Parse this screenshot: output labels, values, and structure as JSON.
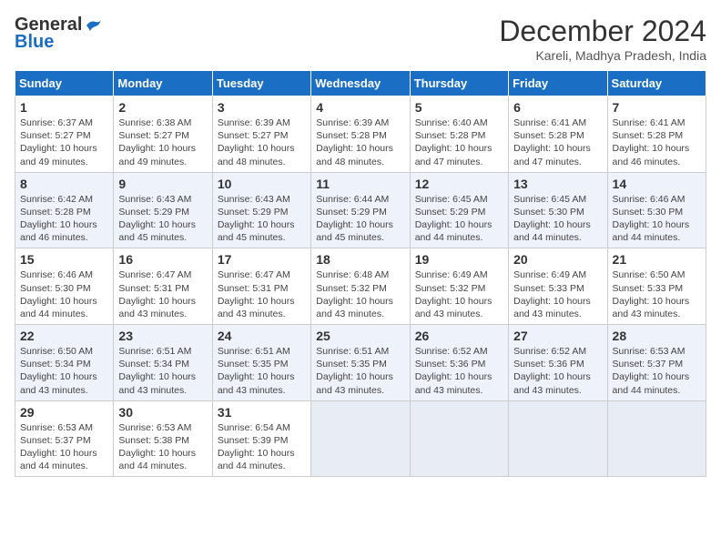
{
  "header": {
    "logo_line1": "General",
    "logo_line2": "Blue",
    "month": "December 2024",
    "location": "Kareli, Madhya Pradesh, India"
  },
  "weekdays": [
    "Sunday",
    "Monday",
    "Tuesday",
    "Wednesday",
    "Thursday",
    "Friday",
    "Saturday"
  ],
  "weeks": [
    [
      {
        "day": "1",
        "info": "Sunrise: 6:37 AM\nSunset: 5:27 PM\nDaylight: 10 hours\nand 49 minutes."
      },
      {
        "day": "2",
        "info": "Sunrise: 6:38 AM\nSunset: 5:27 PM\nDaylight: 10 hours\nand 49 minutes."
      },
      {
        "day": "3",
        "info": "Sunrise: 6:39 AM\nSunset: 5:27 PM\nDaylight: 10 hours\nand 48 minutes."
      },
      {
        "day": "4",
        "info": "Sunrise: 6:39 AM\nSunset: 5:28 PM\nDaylight: 10 hours\nand 48 minutes."
      },
      {
        "day": "5",
        "info": "Sunrise: 6:40 AM\nSunset: 5:28 PM\nDaylight: 10 hours\nand 47 minutes."
      },
      {
        "day": "6",
        "info": "Sunrise: 6:41 AM\nSunset: 5:28 PM\nDaylight: 10 hours\nand 47 minutes."
      },
      {
        "day": "7",
        "info": "Sunrise: 6:41 AM\nSunset: 5:28 PM\nDaylight: 10 hours\nand 46 minutes."
      }
    ],
    [
      {
        "day": "8",
        "info": "Sunrise: 6:42 AM\nSunset: 5:28 PM\nDaylight: 10 hours\nand 46 minutes."
      },
      {
        "day": "9",
        "info": "Sunrise: 6:43 AM\nSunset: 5:29 PM\nDaylight: 10 hours\nand 45 minutes."
      },
      {
        "day": "10",
        "info": "Sunrise: 6:43 AM\nSunset: 5:29 PM\nDaylight: 10 hours\nand 45 minutes."
      },
      {
        "day": "11",
        "info": "Sunrise: 6:44 AM\nSunset: 5:29 PM\nDaylight: 10 hours\nand 45 minutes."
      },
      {
        "day": "12",
        "info": "Sunrise: 6:45 AM\nSunset: 5:29 PM\nDaylight: 10 hours\nand 44 minutes."
      },
      {
        "day": "13",
        "info": "Sunrise: 6:45 AM\nSunset: 5:30 PM\nDaylight: 10 hours\nand 44 minutes."
      },
      {
        "day": "14",
        "info": "Sunrise: 6:46 AM\nSunset: 5:30 PM\nDaylight: 10 hours\nand 44 minutes."
      }
    ],
    [
      {
        "day": "15",
        "info": "Sunrise: 6:46 AM\nSunset: 5:30 PM\nDaylight: 10 hours\nand 44 minutes."
      },
      {
        "day": "16",
        "info": "Sunrise: 6:47 AM\nSunset: 5:31 PM\nDaylight: 10 hours\nand 43 minutes."
      },
      {
        "day": "17",
        "info": "Sunrise: 6:47 AM\nSunset: 5:31 PM\nDaylight: 10 hours\nand 43 minutes."
      },
      {
        "day": "18",
        "info": "Sunrise: 6:48 AM\nSunset: 5:32 PM\nDaylight: 10 hours\nand 43 minutes."
      },
      {
        "day": "19",
        "info": "Sunrise: 6:49 AM\nSunset: 5:32 PM\nDaylight: 10 hours\nand 43 minutes."
      },
      {
        "day": "20",
        "info": "Sunrise: 6:49 AM\nSunset: 5:33 PM\nDaylight: 10 hours\nand 43 minutes."
      },
      {
        "day": "21",
        "info": "Sunrise: 6:50 AM\nSunset: 5:33 PM\nDaylight: 10 hours\nand 43 minutes."
      }
    ],
    [
      {
        "day": "22",
        "info": "Sunrise: 6:50 AM\nSunset: 5:34 PM\nDaylight: 10 hours\nand 43 minutes."
      },
      {
        "day": "23",
        "info": "Sunrise: 6:51 AM\nSunset: 5:34 PM\nDaylight: 10 hours\nand 43 minutes."
      },
      {
        "day": "24",
        "info": "Sunrise: 6:51 AM\nSunset: 5:35 PM\nDaylight: 10 hours\nand 43 minutes."
      },
      {
        "day": "25",
        "info": "Sunrise: 6:51 AM\nSunset: 5:35 PM\nDaylight: 10 hours\nand 43 minutes."
      },
      {
        "day": "26",
        "info": "Sunrise: 6:52 AM\nSunset: 5:36 PM\nDaylight: 10 hours\nand 43 minutes."
      },
      {
        "day": "27",
        "info": "Sunrise: 6:52 AM\nSunset: 5:36 PM\nDaylight: 10 hours\nand 43 minutes."
      },
      {
        "day": "28",
        "info": "Sunrise: 6:53 AM\nSunset: 5:37 PM\nDaylight: 10 hours\nand 44 minutes."
      }
    ],
    [
      {
        "day": "29",
        "info": "Sunrise: 6:53 AM\nSunset: 5:37 PM\nDaylight: 10 hours\nand 44 minutes."
      },
      {
        "day": "30",
        "info": "Sunrise: 6:53 AM\nSunset: 5:38 PM\nDaylight: 10 hours\nand 44 minutes."
      },
      {
        "day": "31",
        "info": "Sunrise: 6:54 AM\nSunset: 5:39 PM\nDaylight: 10 hours\nand 44 minutes."
      },
      {
        "day": "",
        "info": ""
      },
      {
        "day": "",
        "info": ""
      },
      {
        "day": "",
        "info": ""
      },
      {
        "day": "",
        "info": ""
      }
    ]
  ]
}
